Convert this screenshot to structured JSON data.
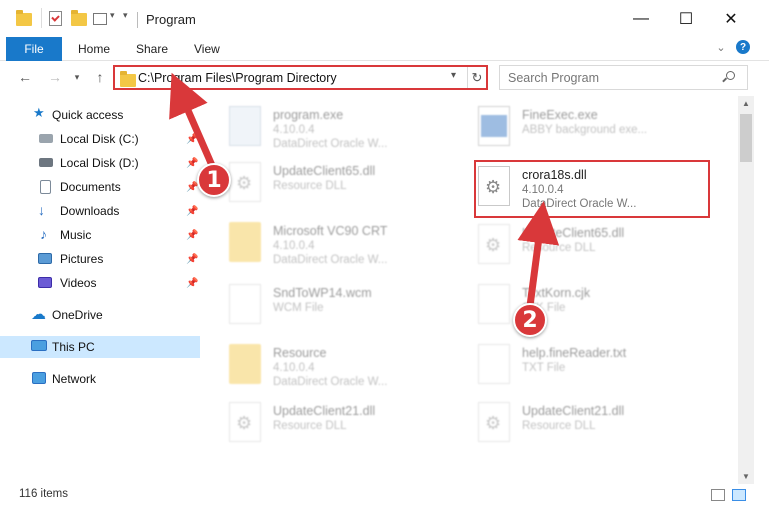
{
  "window": {
    "title": "Program",
    "minimize_glyph": "—",
    "maximize_glyph": "☐",
    "close_glyph": "✕"
  },
  "ribbon": {
    "tabs": [
      "File",
      "Home",
      "Share",
      "View"
    ],
    "help_glyph": "?"
  },
  "address": {
    "path": "C:\\Program Files\\Program Directory",
    "search_placeholder": "Search Program"
  },
  "sidebar": {
    "items": [
      {
        "label": "Quick access",
        "icon": "star-icon"
      },
      {
        "label": "Local Disk (C:)",
        "icon": "drive-icon"
      },
      {
        "label": "Local Disk (D:)",
        "icon": "drive-icon"
      },
      {
        "label": "Documents",
        "icon": "documents-icon"
      },
      {
        "label": "Downloads",
        "icon": "downloads-icon"
      },
      {
        "label": "Music",
        "icon": "music-icon"
      },
      {
        "label": "Pictures",
        "icon": "pictures-icon"
      },
      {
        "label": "Videos",
        "icon": "videos-icon"
      },
      {
        "label": "OneDrive",
        "icon": "cloud-icon"
      },
      {
        "label": "This PC",
        "icon": "computer-icon"
      },
      {
        "label": "Network",
        "icon": "network-icon"
      }
    ]
  },
  "files": [
    {
      "name": "program.exe",
      "line1": "4.10.0.4",
      "line2": "DataDirect Oracle W...",
      "icon": "exe-icon"
    },
    {
      "name": "FineExec.exe",
      "line1": "ABBY background exe...",
      "line2": "",
      "icon": "exe-icon"
    },
    {
      "name": "UpdateClient65.dll",
      "line1": "Resource DLL",
      "line2": "",
      "icon": "dll-icon"
    },
    {
      "name": "crora18s.dll",
      "line1": "4.10.0.4",
      "line2": "DataDirect Oracle W...",
      "icon": "dll-icon"
    },
    {
      "name": "Microsoft VC90 CRT",
      "line1": "4.10.0.4",
      "line2": "DataDirect Oracle W...",
      "icon": "folder-icon"
    },
    {
      "name": "UpdateClient65.dll",
      "line1": "Resource DLL",
      "line2": "",
      "icon": "dll-icon"
    },
    {
      "name": "SndToWP14.wcm",
      "line1": "WCM File",
      "line2": "",
      "icon": "file-icon"
    },
    {
      "name": "TextKorn.cjk",
      "line1": "CJK File",
      "line2": "",
      "icon": "file-icon"
    },
    {
      "name": "Resource",
      "line1": "4.10.0.4",
      "line2": "DataDirect Oracle W...",
      "icon": "folder-icon"
    },
    {
      "name": "help.fineReader.txt",
      "line1": "TXT File",
      "line2": "",
      "icon": "file-icon"
    },
    {
      "name": "UpdateClient21.dll",
      "line1": "Resource DLL",
      "line2": "",
      "icon": "dll-icon"
    },
    {
      "name": "UpdateClient21.dll",
      "line1": "Resource DLL",
      "line2": "",
      "icon": "dll-icon"
    }
  ],
  "status": {
    "item_count": "116 items"
  },
  "annotations": {
    "step1": "1",
    "step2": "2",
    "color": "#d9383a"
  }
}
